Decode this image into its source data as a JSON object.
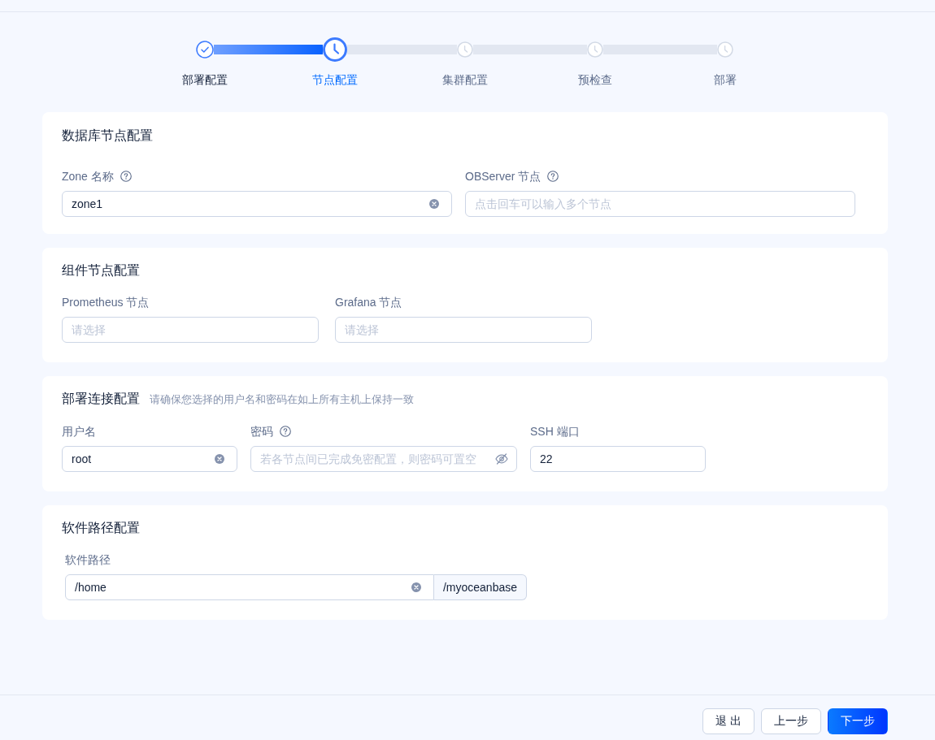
{
  "steps": [
    {
      "label": "部署配置",
      "done": true,
      "selected": false
    },
    {
      "label": "节点配置",
      "done": false,
      "selected": true
    },
    {
      "label": "集群配置",
      "done": false,
      "selected": false
    },
    {
      "label": "预检查",
      "done": false,
      "selected": false
    },
    {
      "label": "部署",
      "done": false,
      "selected": false
    }
  ],
  "sections": [
    {
      "title": "数据库节点配置",
      "fields": [
        {
          "kind": "input",
          "label": "Zone 名称",
          "help": true,
          "value": "zone1",
          "clearable": true
        },
        {
          "kind": "input",
          "label": "OBServer 节点",
          "help": true,
          "placeholder": "点击回车可以输入多个节点",
          "clearable": false
        }
      ]
    },
    {
      "title": "组件节点配置",
      "fields": [
        {
          "kind": "input",
          "label": "Prometheus 节点",
          "help": false,
          "placeholder": "请选择",
          "clearable": false
        },
        {
          "kind": "input",
          "label": "Grafana 节点",
          "help": false,
          "placeholder": "请选择",
          "clearable": false
        }
      ]
    },
    {
      "title": "部署连接配置",
      "description": "请确保您选择的用户名和密码在如上所有主机上保持一致",
      "fields": [
        {
          "kind": "input",
          "label": "用户名",
          "help": false,
          "value": "root",
          "clearable": true
        },
        {
          "kind": "password",
          "label": "密码",
          "help": true,
          "placeholder": "若各节点间已完成免密配置，则密码可置空",
          "clearable": false
        },
        {
          "kind": "input",
          "label": "SSH 端口",
          "help": false,
          "value": "22",
          "clearable": false
        }
      ]
    },
    {
      "title": "软件路径配置",
      "fields": [
        {
          "kind": "input",
          "label": "软件路径",
          "help": false,
          "value": "/home",
          "clearable": true,
          "addon": "/myoceanbase"
        }
      ]
    }
  ],
  "footer": {
    "buttons": [
      {
        "label": "退 出",
        "kind": "default"
      },
      {
        "label": "上一步",
        "kind": "default"
      },
      {
        "label": "下一步",
        "kind": "primary"
      }
    ]
  }
}
